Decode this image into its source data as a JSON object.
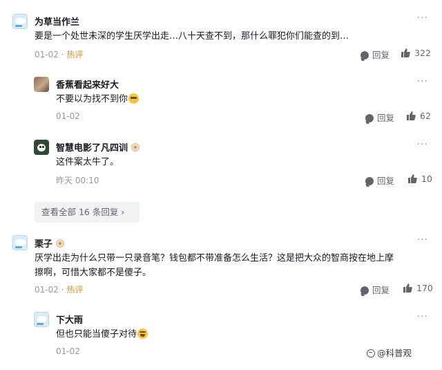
{
  "comments": [
    {
      "username": "为草当作兰",
      "text": "要是一个处世未深的学生厌学出走…八十天查不到，那什么罪犯你们能查的到…",
      "date": "01-02",
      "hot_label": "热评",
      "reply_label": "回复",
      "likes": "322",
      "more": "···",
      "replies": [
        {
          "username": "香蕉看起来好大",
          "text": "不要以为找不到你",
          "emoji": "sunglasses-emoji",
          "date": "01-02",
          "reply_label": "回复",
          "likes": "62",
          "more": "···"
        },
        {
          "username": "智慧电影了凡四训",
          "text": "这件案太牛了。",
          "date": "昨天 00:10",
          "reply_label": "回复",
          "likes": "10",
          "more": "···"
        }
      ],
      "view_all": "查看全部 16 条回复 ›"
    },
    {
      "username": "栗子",
      "text_line1": "厌学出走为什么只带一只录音笔？钱包都不带准备怎么生活？这是把大众的智商按在地上摩",
      "text_line2": "擦啊，可惜大家都不是傻子。",
      "date": "01-02",
      "hot_label": "热评",
      "reply_label": "回复",
      "likes": "170",
      "more": "···",
      "replies": [
        {
          "username": "下大雨",
          "text": "但也只能当傻子对待",
          "emoji": "laugh-cry-emoji",
          "date": "01-02",
          "more": "···"
        }
      ]
    }
  ],
  "watermark": "@科普观",
  "colors": {
    "hot": "#e3902b",
    "meta": "#9499a0",
    "action": "#61666d"
  }
}
